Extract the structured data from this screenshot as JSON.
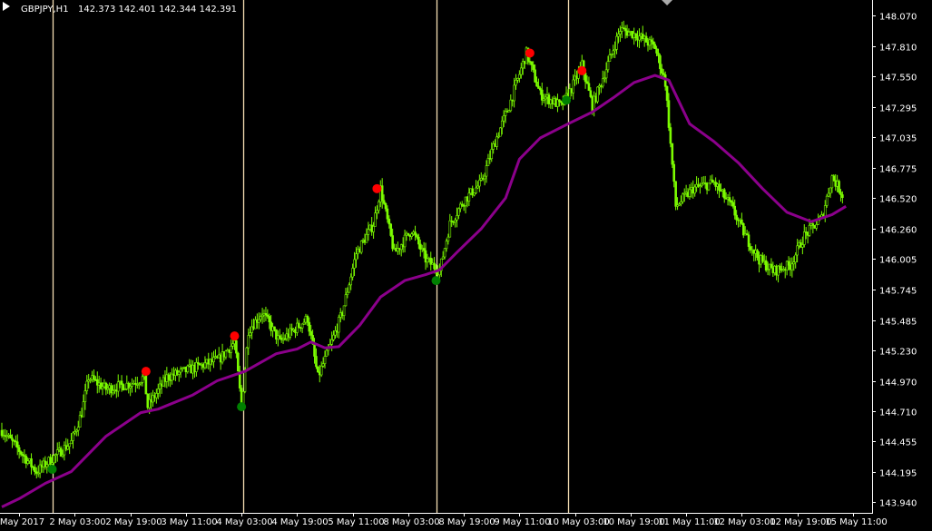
{
  "header": {
    "symbol": "GBPJPY,H1",
    "quote": "142.373 142.401 142.344 142.391"
  },
  "colors": {
    "background": "#000000",
    "candle": "#7CFC00",
    "moving_average": "#8B008B",
    "separator": "#F5DEB3",
    "signal_sell": "#FF0000",
    "signal_buy": "#008000",
    "axis_text": "#FFFFFF"
  },
  "chart_data": {
    "type": "candlestick",
    "symbol": "GBPJPY",
    "timeframe": "H1",
    "ylim": [
      143.85,
      148.2
    ],
    "xlim": [
      0,
      500
    ],
    "y_ticks": [
      "148.070",
      "147.810",
      "147.550",
      "147.295",
      "147.035",
      "146.775",
      "146.520",
      "146.260",
      "146.005",
      "145.745",
      "145.485",
      "145.230",
      "144.970",
      "144.710",
      "144.455",
      "144.195",
      "143.940"
    ],
    "x_ticks": [
      {
        "i": 10,
        "label": "May 2017"
      },
      {
        "i": 42,
        "label": "2 May 03:00"
      },
      {
        "i": 74,
        "label": "2 May 19:00"
      },
      {
        "i": 106,
        "label": "3 May 11:00"
      },
      {
        "i": 138,
        "label": "4 May 03:00"
      },
      {
        "i": 170,
        "label": "4 May 19:00"
      },
      {
        "i": 202,
        "label": "5 May 11:00"
      },
      {
        "i": 234,
        "label": "8 May 03:00"
      },
      {
        "i": 266,
        "label": "8 May 19:00"
      },
      {
        "i": 298,
        "label": "9 May 11:00"
      },
      {
        "i": 330,
        "label": "10 May 03:00"
      },
      {
        "i": 362,
        "label": "10 May 19:00"
      },
      {
        "i": 394,
        "label": "11 May 11:00"
      },
      {
        "i": 426,
        "label": "12 May 03:00"
      },
      {
        "i": 458,
        "label": "12 May 19:00"
      },
      {
        "i": 490,
        "label": "15 May 11:00"
      }
    ],
    "price_path": [
      [
        0,
        144.55
      ],
      [
        10,
        144.38
      ],
      [
        20,
        144.2
      ],
      [
        28,
        144.3
      ],
      [
        40,
        144.45
      ],
      [
        46,
        144.7
      ],
      [
        50,
        145.0
      ],
      [
        60,
        144.9
      ],
      [
        75,
        144.95
      ],
      [
        82,
        145.0
      ],
      [
        84,
        144.75
      ],
      [
        95,
        145.0
      ],
      [
        105,
        145.05
      ],
      [
        115,
        145.1
      ],
      [
        125,
        145.15
      ],
      [
        134,
        145.3
      ],
      [
        138,
        144.75
      ],
      [
        142,
        145.4
      ],
      [
        150,
        145.55
      ],
      [
        160,
        145.3
      ],
      [
        168,
        145.4
      ],
      [
        176,
        145.5
      ],
      [
        182,
        145.0
      ],
      [
        190,
        145.3
      ],
      [
        196,
        145.55
      ],
      [
        204,
        146.05
      ],
      [
        214,
        146.3
      ],
      [
        218,
        146.6
      ],
      [
        226,
        146.05
      ],
      [
        236,
        146.25
      ],
      [
        244,
        146.0
      ],
      [
        252,
        145.9
      ],
      [
        258,
        146.3
      ],
      [
        266,
        146.5
      ],
      [
        276,
        146.65
      ],
      [
        284,
        147.0
      ],
      [
        292,
        147.3
      ],
      [
        302,
        147.75
      ],
      [
        310,
        147.4
      ],
      [
        322,
        147.3
      ],
      [
        328,
        147.45
      ],
      [
        334,
        147.65
      ],
      [
        340,
        147.3
      ],
      [
        350,
        147.7
      ],
      [
        356,
        147.95
      ],
      [
        366,
        147.9
      ],
      [
        376,
        147.8
      ],
      [
        382,
        147.5
      ],
      [
        388,
        146.45
      ],
      [
        398,
        146.6
      ],
      [
        410,
        146.65
      ],
      [
        420,
        146.45
      ],
      [
        428,
        146.2
      ],
      [
        436,
        146.0
      ],
      [
        444,
        145.9
      ],
      [
        454,
        145.95
      ],
      [
        462,
        146.2
      ],
      [
        472,
        146.35
      ],
      [
        478,
        146.7
      ],
      [
        484,
        146.55
      ]
    ],
    "moving_average": [
      [
        0,
        143.9
      ],
      [
        10,
        143.97
      ],
      [
        25,
        144.1
      ],
      [
        40,
        144.2
      ],
      [
        60,
        144.5
      ],
      [
        80,
        144.7
      ],
      [
        90,
        144.73
      ],
      [
        110,
        144.85
      ],
      [
        124,
        144.97
      ],
      [
        140,
        145.05
      ],
      [
        158,
        145.2
      ],
      [
        170,
        145.24
      ],
      [
        178,
        145.3
      ],
      [
        186,
        145.25
      ],
      [
        194,
        145.26
      ],
      [
        206,
        145.44
      ],
      [
        218,
        145.68
      ],
      [
        232,
        145.82
      ],
      [
        244,
        145.87
      ],
      [
        252,
        145.91
      ],
      [
        262,
        146.06
      ],
      [
        276,
        146.26
      ],
      [
        290,
        146.52
      ],
      [
        298,
        146.85
      ],
      [
        310,
        147.03
      ],
      [
        326,
        147.15
      ],
      [
        340,
        147.25
      ],
      [
        352,
        147.37
      ],
      [
        364,
        147.5
      ],
      [
        376,
        147.56
      ],
      [
        384,
        147.52
      ],
      [
        396,
        147.15
      ],
      [
        410,
        147.0
      ],
      [
        424,
        146.82
      ],
      [
        438,
        146.6
      ],
      [
        452,
        146.4
      ],
      [
        466,
        146.32
      ],
      [
        478,
        146.38
      ],
      [
        486,
        146.45
      ]
    ],
    "separators": [
      29,
      139,
      250,
      326
    ],
    "signals": [
      {
        "i": 29,
        "price": 144.22,
        "type": "buy"
      },
      {
        "i": 83,
        "price": 145.05,
        "type": "sell"
      },
      {
        "i": 134,
        "price": 145.35,
        "type": "sell"
      },
      {
        "i": 138,
        "price": 144.75,
        "type": "buy"
      },
      {
        "i": 216,
        "price": 146.6,
        "type": "sell"
      },
      {
        "i": 250,
        "price": 145.82,
        "type": "buy"
      },
      {
        "i": 304,
        "price": 147.75,
        "type": "sell"
      },
      {
        "i": 325,
        "price": 147.35,
        "type": "buy"
      },
      {
        "i": 334,
        "price": 147.6,
        "type": "sell"
      }
    ],
    "market_marker_i": 383
  }
}
